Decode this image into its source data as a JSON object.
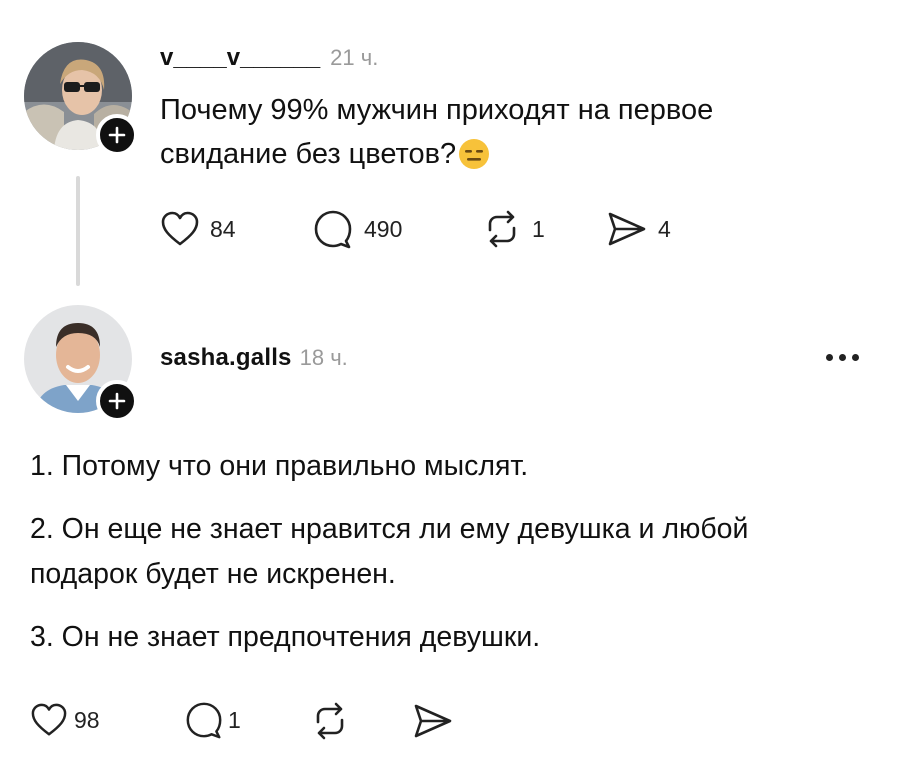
{
  "post": {
    "username": "v____v______",
    "time": "21 ч.",
    "text_line1": "Почему 99% мужчин приходят на первое",
    "text_line2": "свидание без цветов?",
    "emoji": "😑",
    "likes": "84",
    "comments": "490",
    "reposts": "1",
    "shares": "4"
  },
  "reply": {
    "username": "sasha.galls",
    "time": "18 ч.",
    "paragraph1": "1. Потому что они правильно мыслят.",
    "paragraph2_line1": "2. Он еще не знает нравится ли ему девушка и любой",
    "paragraph2_line2": "подарок будет не искренен.",
    "paragraph3": "3. Он не знает предпочтения девушки.",
    "likes": "98",
    "comments": "1"
  },
  "icons": {
    "like": "heart-icon",
    "comment": "comment-bubble-icon",
    "repost": "repost-icon",
    "share": "send-icon",
    "follow": "plus-icon",
    "more": "more-dots-icon"
  },
  "colors": {
    "text": "#111111",
    "muted": "#9a9a9a",
    "thread_line": "#d9d9d9",
    "follow_badge": "#101010"
  }
}
